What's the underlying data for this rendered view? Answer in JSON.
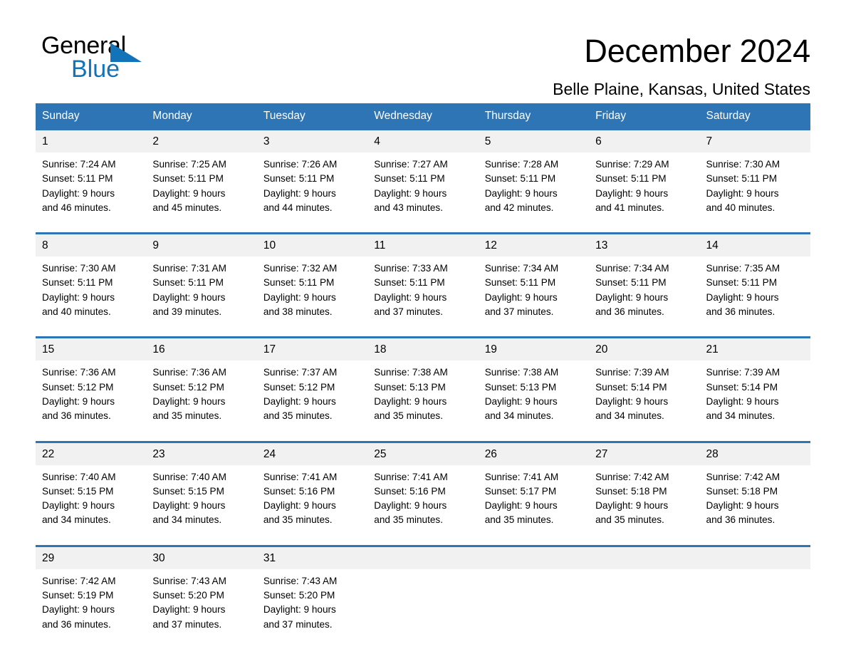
{
  "brand": {
    "name_part1": "General",
    "name_part2": "Blue",
    "triangle_icon": "blue-triangle-logo-mark",
    "accent_color": "#1273b8"
  },
  "header": {
    "title": "December 2024",
    "location": "Belle Plaine, Kansas, United States"
  },
  "theme": {
    "header_row_bg": "#2e75b6",
    "daynum_bg": "#f1f1f1",
    "row_divider": "#2e75b6"
  },
  "calendar": {
    "weekday_headers": [
      "Sunday",
      "Monday",
      "Tuesday",
      "Wednesday",
      "Thursday",
      "Friday",
      "Saturday"
    ],
    "weeks": [
      [
        {
          "day": "1",
          "sunrise": "Sunrise: 7:24 AM",
          "sunset": "Sunset: 5:11 PM",
          "daylight_line1": "Daylight: 9 hours",
          "daylight_line2": "and 46 minutes."
        },
        {
          "day": "2",
          "sunrise": "Sunrise: 7:25 AM",
          "sunset": "Sunset: 5:11 PM",
          "daylight_line1": "Daylight: 9 hours",
          "daylight_line2": "and 45 minutes."
        },
        {
          "day": "3",
          "sunrise": "Sunrise: 7:26 AM",
          "sunset": "Sunset: 5:11 PM",
          "daylight_line1": "Daylight: 9 hours",
          "daylight_line2": "and 44 minutes."
        },
        {
          "day": "4",
          "sunrise": "Sunrise: 7:27 AM",
          "sunset": "Sunset: 5:11 PM",
          "daylight_line1": "Daylight: 9 hours",
          "daylight_line2": "and 43 minutes."
        },
        {
          "day": "5",
          "sunrise": "Sunrise: 7:28 AM",
          "sunset": "Sunset: 5:11 PM",
          "daylight_line1": "Daylight: 9 hours",
          "daylight_line2": "and 42 minutes."
        },
        {
          "day": "6",
          "sunrise": "Sunrise: 7:29 AM",
          "sunset": "Sunset: 5:11 PM",
          "daylight_line1": "Daylight: 9 hours",
          "daylight_line2": "and 41 minutes."
        },
        {
          "day": "7",
          "sunrise": "Sunrise: 7:30 AM",
          "sunset": "Sunset: 5:11 PM",
          "daylight_line1": "Daylight: 9 hours",
          "daylight_line2": "and 40 minutes."
        }
      ],
      [
        {
          "day": "8",
          "sunrise": "Sunrise: 7:30 AM",
          "sunset": "Sunset: 5:11 PM",
          "daylight_line1": "Daylight: 9 hours",
          "daylight_line2": "and 40 minutes."
        },
        {
          "day": "9",
          "sunrise": "Sunrise: 7:31 AM",
          "sunset": "Sunset: 5:11 PM",
          "daylight_line1": "Daylight: 9 hours",
          "daylight_line2": "and 39 minutes."
        },
        {
          "day": "10",
          "sunrise": "Sunrise: 7:32 AM",
          "sunset": "Sunset: 5:11 PM",
          "daylight_line1": "Daylight: 9 hours",
          "daylight_line2": "and 38 minutes."
        },
        {
          "day": "11",
          "sunrise": "Sunrise: 7:33 AM",
          "sunset": "Sunset: 5:11 PM",
          "daylight_line1": "Daylight: 9 hours",
          "daylight_line2": "and 37 minutes."
        },
        {
          "day": "12",
          "sunrise": "Sunrise: 7:34 AM",
          "sunset": "Sunset: 5:11 PM",
          "daylight_line1": "Daylight: 9 hours",
          "daylight_line2": "and 37 minutes."
        },
        {
          "day": "13",
          "sunrise": "Sunrise: 7:34 AM",
          "sunset": "Sunset: 5:11 PM",
          "daylight_line1": "Daylight: 9 hours",
          "daylight_line2": "and 36 minutes."
        },
        {
          "day": "14",
          "sunrise": "Sunrise: 7:35 AM",
          "sunset": "Sunset: 5:11 PM",
          "daylight_line1": "Daylight: 9 hours",
          "daylight_line2": "and 36 minutes."
        }
      ],
      [
        {
          "day": "15",
          "sunrise": "Sunrise: 7:36 AM",
          "sunset": "Sunset: 5:12 PM",
          "daylight_line1": "Daylight: 9 hours",
          "daylight_line2": "and 36 minutes."
        },
        {
          "day": "16",
          "sunrise": "Sunrise: 7:36 AM",
          "sunset": "Sunset: 5:12 PM",
          "daylight_line1": "Daylight: 9 hours",
          "daylight_line2": "and 35 minutes."
        },
        {
          "day": "17",
          "sunrise": "Sunrise: 7:37 AM",
          "sunset": "Sunset: 5:12 PM",
          "daylight_line1": "Daylight: 9 hours",
          "daylight_line2": "and 35 minutes."
        },
        {
          "day": "18",
          "sunrise": "Sunrise: 7:38 AM",
          "sunset": "Sunset: 5:13 PM",
          "daylight_line1": "Daylight: 9 hours",
          "daylight_line2": "and 35 minutes."
        },
        {
          "day": "19",
          "sunrise": "Sunrise: 7:38 AM",
          "sunset": "Sunset: 5:13 PM",
          "daylight_line1": "Daylight: 9 hours",
          "daylight_line2": "and 34 minutes."
        },
        {
          "day": "20",
          "sunrise": "Sunrise: 7:39 AM",
          "sunset": "Sunset: 5:14 PM",
          "daylight_line1": "Daylight: 9 hours",
          "daylight_line2": "and 34 minutes."
        },
        {
          "day": "21",
          "sunrise": "Sunrise: 7:39 AM",
          "sunset": "Sunset: 5:14 PM",
          "daylight_line1": "Daylight: 9 hours",
          "daylight_line2": "and 34 minutes."
        }
      ],
      [
        {
          "day": "22",
          "sunrise": "Sunrise: 7:40 AM",
          "sunset": "Sunset: 5:15 PM",
          "daylight_line1": "Daylight: 9 hours",
          "daylight_line2": "and 34 minutes."
        },
        {
          "day": "23",
          "sunrise": "Sunrise: 7:40 AM",
          "sunset": "Sunset: 5:15 PM",
          "daylight_line1": "Daylight: 9 hours",
          "daylight_line2": "and 34 minutes."
        },
        {
          "day": "24",
          "sunrise": "Sunrise: 7:41 AM",
          "sunset": "Sunset: 5:16 PM",
          "daylight_line1": "Daylight: 9 hours",
          "daylight_line2": "and 35 minutes."
        },
        {
          "day": "25",
          "sunrise": "Sunrise: 7:41 AM",
          "sunset": "Sunset: 5:16 PM",
          "daylight_line1": "Daylight: 9 hours",
          "daylight_line2": "and 35 minutes."
        },
        {
          "day": "26",
          "sunrise": "Sunrise: 7:41 AM",
          "sunset": "Sunset: 5:17 PM",
          "daylight_line1": "Daylight: 9 hours",
          "daylight_line2": "and 35 minutes."
        },
        {
          "day": "27",
          "sunrise": "Sunrise: 7:42 AM",
          "sunset": "Sunset: 5:18 PM",
          "daylight_line1": "Daylight: 9 hours",
          "daylight_line2": "and 35 minutes."
        },
        {
          "day": "28",
          "sunrise": "Sunrise: 7:42 AM",
          "sunset": "Sunset: 5:18 PM",
          "daylight_line1": "Daylight: 9 hours",
          "daylight_line2": "and 36 minutes."
        }
      ],
      [
        {
          "day": "29",
          "sunrise": "Sunrise: 7:42 AM",
          "sunset": "Sunset: 5:19 PM",
          "daylight_line1": "Daylight: 9 hours",
          "daylight_line2": "and 36 minutes."
        },
        {
          "day": "30",
          "sunrise": "Sunrise: 7:43 AM",
          "sunset": "Sunset: 5:20 PM",
          "daylight_line1": "Daylight: 9 hours",
          "daylight_line2": "and 37 minutes."
        },
        {
          "day": "31",
          "sunrise": "Sunrise: 7:43 AM",
          "sunset": "Sunset: 5:20 PM",
          "daylight_line1": "Daylight: 9 hours",
          "daylight_line2": "and 37 minutes."
        },
        {
          "day": "",
          "sunrise": "",
          "sunset": "",
          "daylight_line1": "",
          "daylight_line2": ""
        },
        {
          "day": "",
          "sunrise": "",
          "sunset": "",
          "daylight_line1": "",
          "daylight_line2": ""
        },
        {
          "day": "",
          "sunrise": "",
          "sunset": "",
          "daylight_line1": "",
          "daylight_line2": ""
        },
        {
          "day": "",
          "sunrise": "",
          "sunset": "",
          "daylight_line1": "",
          "daylight_line2": ""
        }
      ]
    ]
  }
}
